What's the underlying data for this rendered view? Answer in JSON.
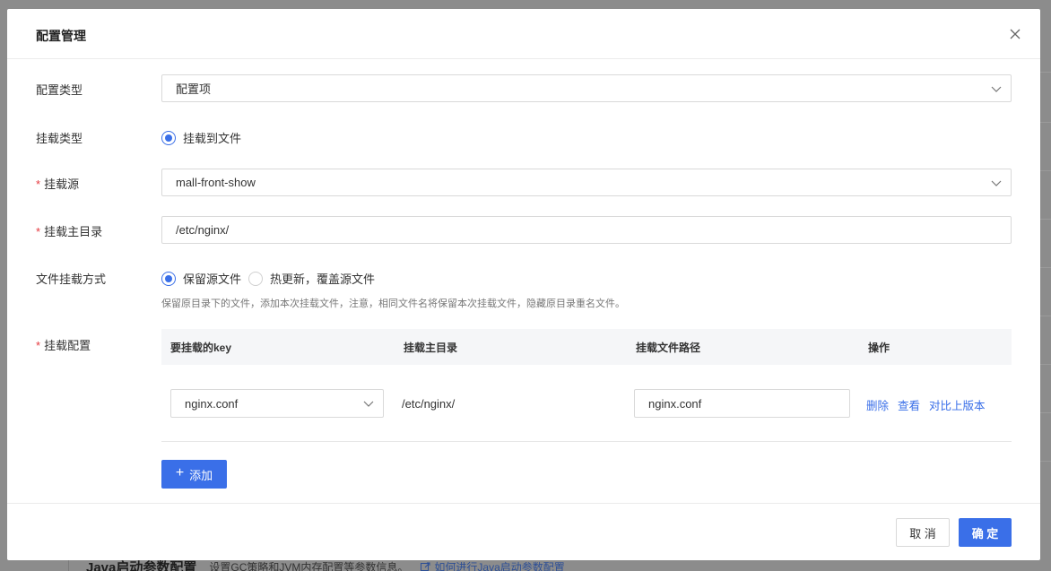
{
  "dialog": {
    "title": "配置管理"
  },
  "form": {
    "config_type": {
      "label": "配置类型",
      "value": "配置项"
    },
    "mount_type": {
      "label": "挂载类型",
      "option": "挂载到文件"
    },
    "mount_source": {
      "label": "挂载源",
      "value": "mall-front-show"
    },
    "mount_dir": {
      "label": "挂载主目录",
      "value": "/etc/nginx/"
    },
    "file_mount_mode": {
      "label": "文件挂载方式",
      "options": [
        "保留源文件",
        "热更新，覆盖源文件"
      ],
      "selected": 0,
      "hint": "保留原目录下的文件，添加本次挂载文件，注意，相同文件名将保留本次挂载文件，隐藏原目录重名文件。"
    },
    "mount_config": {
      "label": "挂载配置",
      "columns": [
        "要挂载的key",
        "挂载主目录",
        "挂载文件路径",
        "操作"
      ],
      "rows": [
        {
          "key": "nginx.conf",
          "dir": "/etc/nginx/",
          "path": "nginx.conf",
          "actions": [
            "删除",
            "查看",
            "对比上版本"
          ]
        }
      ],
      "add_label": "添加"
    }
  },
  "footer": {
    "cancel_label": "取 消",
    "ok_label": "确 定"
  },
  "background": {
    "section_title": "Java启动参数配置",
    "section_desc": "设置GC策略和JVM内存配置等参数信息。",
    "link_text": "如何进行Java启动参数配置"
  },
  "colors": {
    "primary": "#3a6fe8",
    "required": "#e5393f"
  }
}
